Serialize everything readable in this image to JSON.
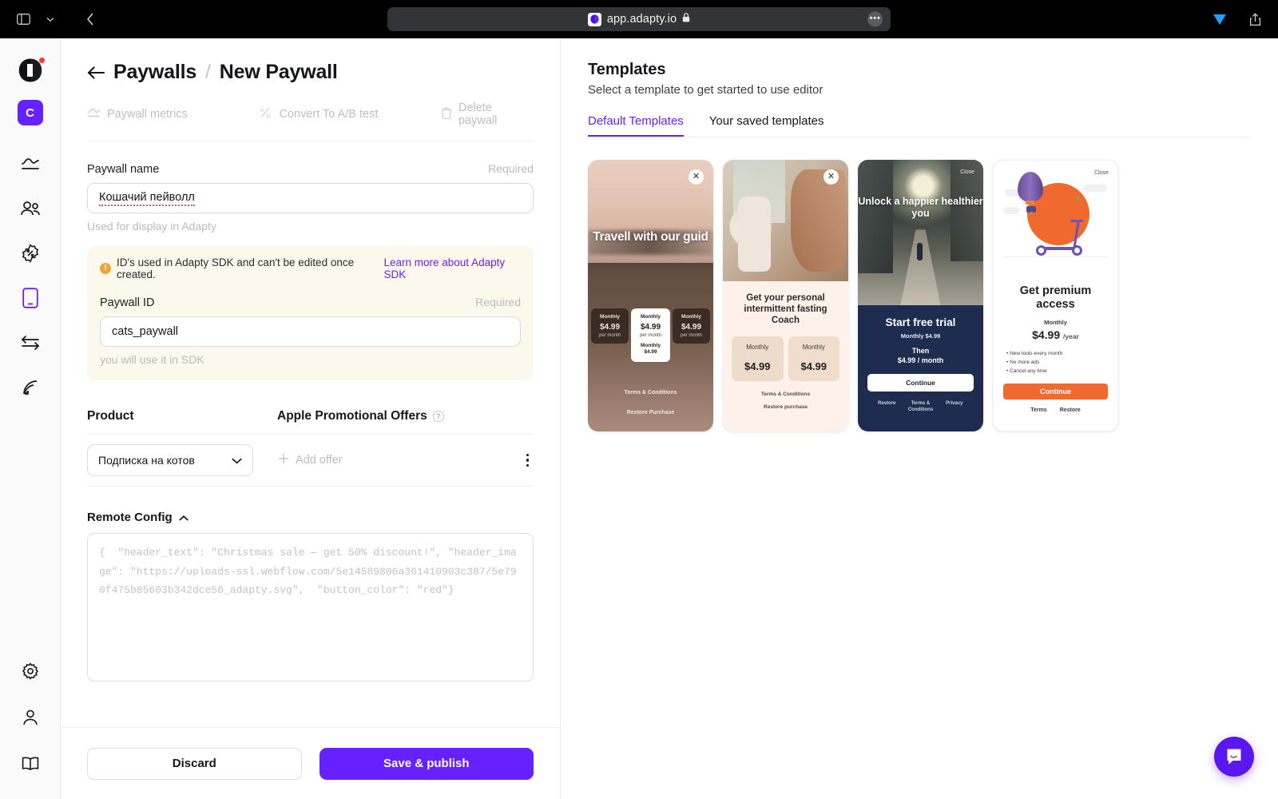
{
  "browser": {
    "url": "app.adapty.io",
    "favicon_icon": "adapty-logo-icon",
    "sidebar_toggle_icon": "sidebar-toggle-icon",
    "tab_overview_icon": "chevron-down-icon",
    "back_icon": "chevron-left-icon",
    "more_label": "•••",
    "lock_icon": "lock-icon",
    "extension_icon": "vimeo-extension-icon",
    "share_icon": "share-icon"
  },
  "rail": {
    "logo_icon": "adapty-logo-icon",
    "notification_dot_color": "#ff3b30",
    "avatar_label": "C",
    "items": [
      {
        "icon": "analytics-chart-icon",
        "name": "analytics",
        "active": false
      },
      {
        "icon": "users-icon",
        "name": "users",
        "active": false
      },
      {
        "icon": "promo-percent-badge-icon",
        "name": "promo-campaigns",
        "active": false
      },
      {
        "icon": "mobile-paywall-icon",
        "name": "paywalls",
        "active": true
      },
      {
        "icon": "integrations-arrows-icon",
        "name": "integrations",
        "active": false
      },
      {
        "icon": "events-broadcast-icon",
        "name": "events",
        "active": false
      }
    ],
    "bottom_items": [
      {
        "icon": "gear-icon",
        "name": "settings"
      },
      {
        "icon": "user-icon",
        "name": "profile"
      },
      {
        "icon": "book-icon",
        "name": "documentation"
      }
    ]
  },
  "header": {
    "back_icon": "arrow-left-icon",
    "breadcrumb_parent": "Paywalls",
    "breadcrumb_sep": "/",
    "breadcrumb_current": "New Paywall"
  },
  "actions": [
    {
      "label": "Paywall metrics",
      "icon": "line-chart-icon"
    },
    {
      "label": "Convert To A/B test",
      "icon": "ab-test-icon"
    },
    {
      "label": "Delete paywall",
      "icon": "trash-icon"
    }
  ],
  "paywall_name": {
    "label": "Paywall name",
    "required": "Required",
    "value": "Кошачий пейволл",
    "hint": "Used for display in Adapty"
  },
  "notice": {
    "warn_icon": "warning-icon",
    "warn_glyph": "!",
    "text": "ID's used in Adapty SDK and can't be edited once created.",
    "link": "Learn more about Adapty SDK"
  },
  "paywall_id": {
    "label": "Paywall ID",
    "required": "Required",
    "value": "cats_paywall",
    "hint": "you will use it in SDK"
  },
  "product_section": {
    "col_product": "Product",
    "col_offers": "Apple Promotional Offers",
    "help_icon": "question-mark-icon",
    "help_glyph": "?",
    "selected_product": "Подписка на котов",
    "chevron_icon": "chevron-down-icon",
    "add_offer_label": "Add offer",
    "add_offer_icon": "plus-icon",
    "kebab_icon": "more-vertical-icon"
  },
  "remote_config": {
    "title": "Remote Config",
    "collapse_icon": "chevron-up-icon",
    "value": "{  \"header_text\": \"Christmas sale — get 50% discount!\", \"header_image\": \"https://uploads-ssl.webflow.com/5e14589806a361410903c387/5e790f475b85603b342dce56_adapty.svg\",  \"button_color\": \"red\"}"
  },
  "footer": {
    "discard_label": "Discard",
    "publish_label": "Save & publish",
    "publish_color": "#6720ff"
  },
  "templates": {
    "title": "Templates",
    "subtitle": "Select a template to get started to use editor",
    "tabs": [
      {
        "label": "Default Templates",
        "active": true
      },
      {
        "label": "Your saved templates",
        "active": false
      }
    ],
    "cards": [
      {
        "name": "travel-template",
        "close_icon": "close-x-icon",
        "close_glyph": "✕",
        "title": "Travell with our guid",
        "prices": [
          {
            "label": "Monthly",
            "price": "$4.99",
            "per": "per month"
          },
          {
            "label": "Monthly",
            "price": "$4.99",
            "per": "per month",
            "sub_label": "Monthly",
            "sub_price": "$4.99"
          },
          {
            "label": "Monthly",
            "price": "$4.99",
            "per": "per month"
          }
        ],
        "terms": "Terms & Conditions",
        "restore": "Restore Purchase"
      },
      {
        "name": "fasting-template",
        "close_icon": "close-x-icon",
        "close_glyph": "✕",
        "title": "Get your personal intermittent fasting Coach",
        "prices": [
          {
            "label": "Monthly",
            "price": "$4.99"
          },
          {
            "label": "Monthly",
            "price": "$4.99"
          }
        ],
        "terms": "Terms & Conditions",
        "restore": "Restore purchase"
      },
      {
        "name": "healthier-you-template",
        "close_label": "Close",
        "title": "Unlock a happier healthier you",
        "heading": "Start free trial",
        "sub": "Monthly  $4.99",
        "then_label": "Then",
        "then_price": "$4.99 / month",
        "cta": "Continue",
        "links": [
          "Restore",
          "Terms & Conditions",
          "Privacy"
        ]
      },
      {
        "name": "premium-access-template",
        "close_label": "Close",
        "title": "Get premium access",
        "monthly": "Monthly",
        "price": "$4.99",
        "period": "/year",
        "bullets": [
          "• New tools every month",
          "• No more ads",
          "• Cancel any time"
        ],
        "cta": "Continue",
        "cta_color": "#f0692e",
        "links": [
          "Terms",
          "Restore"
        ]
      }
    ]
  },
  "chat": {
    "icon": "chat-bubble-icon",
    "color": "#5a17f0"
  }
}
